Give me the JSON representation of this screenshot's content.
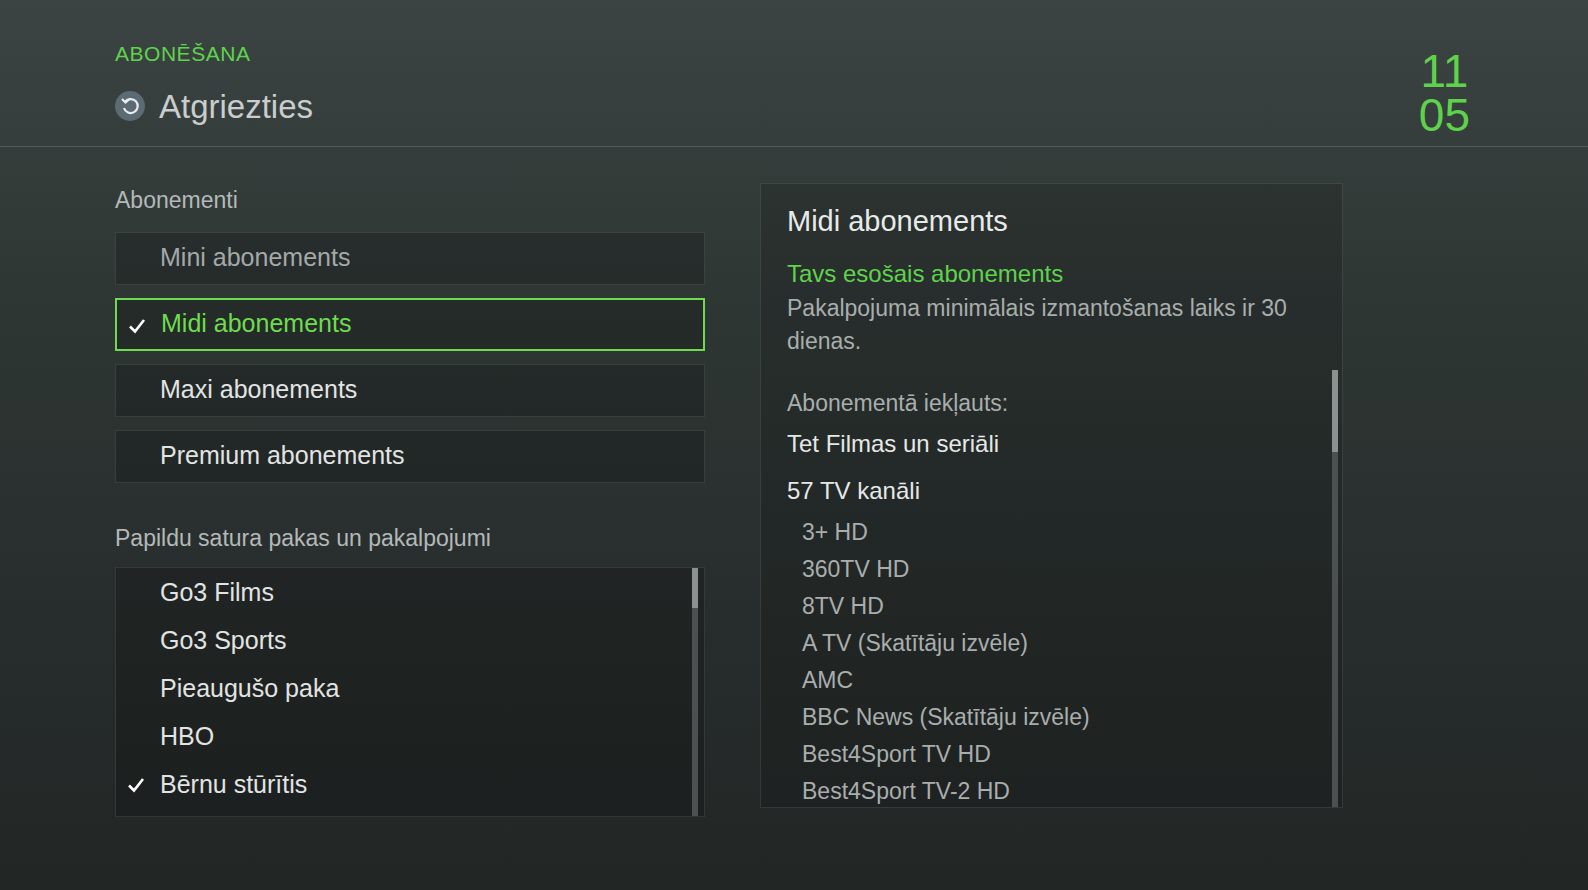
{
  "header": {
    "section": "ABONĒŠANA",
    "back": "Atgriezties"
  },
  "clock": {
    "hours": "11",
    "minutes": "05"
  },
  "subscriptions": {
    "label": "Abonementi",
    "items": [
      {
        "label": "Mini abonements",
        "selected": false,
        "checked": false,
        "disabled": true
      },
      {
        "label": "Midi abonements",
        "selected": true,
        "checked": true,
        "disabled": false
      },
      {
        "label": "Maxi abonements",
        "selected": false,
        "checked": false,
        "disabled": false
      },
      {
        "label": "Premium abonements",
        "selected": false,
        "checked": false,
        "disabled": false
      }
    ]
  },
  "addons": {
    "label": "Papildu satura pakas un pakalpojumi",
    "items": [
      {
        "label": "Go3 Films",
        "checked": false
      },
      {
        "label": "Go3 Sports",
        "checked": false
      },
      {
        "label": "Pieaugušo paka",
        "checked": false
      },
      {
        "label": "HBO",
        "checked": false
      },
      {
        "label": "Bērnu stūrītis",
        "checked": true
      }
    ]
  },
  "details": {
    "title": "Midi abonements",
    "status": "Tavs esošais abonements",
    "description": "Pakalpojuma minimālais izmantošanas laiks ir 30 dienas.",
    "included_label": "Abonementā iekļauts:",
    "included": [
      "Tet Filmas un seriāli",
      "57 TV kanāli"
    ],
    "channels": [
      "3+ HD",
      "360TV HD",
      "8TV HD",
      "A TV (Skatītāju izvēle)",
      "AMC",
      "BBC News (Skatītāju izvēle)",
      "Best4Sport TV HD",
      "Best4Sport TV-2 HD"
    ]
  }
}
